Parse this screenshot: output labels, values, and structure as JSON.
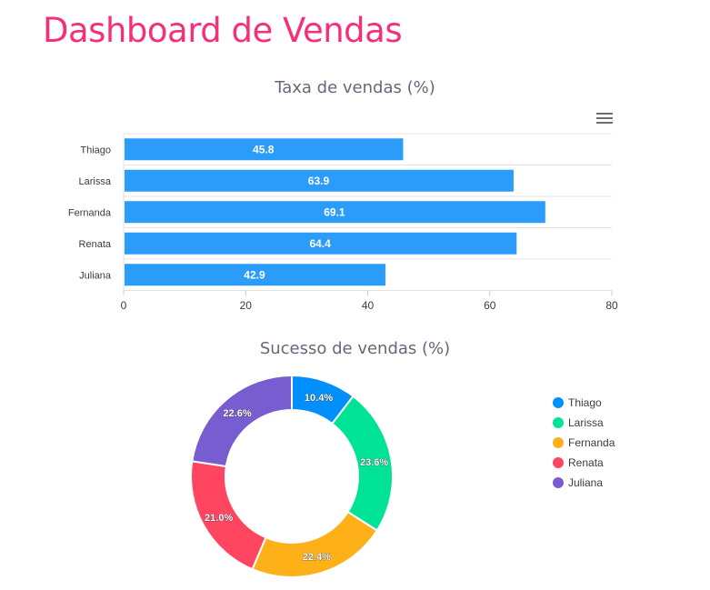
{
  "page": {
    "title": "Dashboard de Vendas"
  },
  "colors": {
    "title": "#f5307a",
    "bar": "#2b9cfa"
  },
  "chart_data": [
    {
      "type": "bar",
      "orientation": "horizontal",
      "title": "Taxa de vendas (%)",
      "categories": [
        "Thiago",
        "Larissa",
        "Fernanda",
        "Renata",
        "Juliana"
      ],
      "values": [
        45.8,
        63.9,
        69.1,
        64.4,
        42.9
      ],
      "xlim": [
        0,
        80
      ],
      "xticks": [
        "0",
        "20",
        "40",
        "60",
        "80"
      ],
      "grid": "horizontal",
      "data_labels": true,
      "menu_icon": "hamburger-menu-icon"
    },
    {
      "type": "pie",
      "variant": "donut",
      "title": "Sucesso de vendas (%)",
      "labels": [
        "Thiago",
        "Larissa",
        "Fernanda",
        "Renata",
        "Juliana"
      ],
      "values": [
        10.4,
        23.6,
        22.4,
        21.0,
        22.6
      ],
      "value_labels": [
        "10.4%",
        "23.6%",
        "22.4%",
        "21.0%",
        "22.6%"
      ],
      "colors": [
        "#008ffb",
        "#00e396",
        "#feb019",
        "#ff4560",
        "#775dd0"
      ],
      "legend_position": "right"
    }
  ]
}
